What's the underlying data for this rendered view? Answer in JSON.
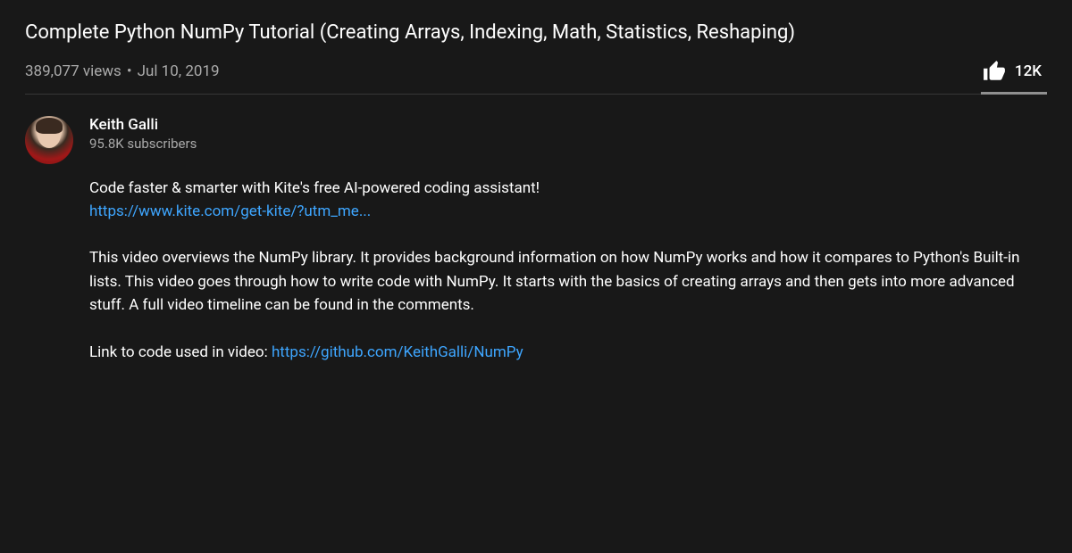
{
  "video": {
    "title": "Complete Python NumPy Tutorial (Creating Arrays, Indexing, Math, Statistics, Reshaping)",
    "views": "389,077 views",
    "date": "Jul 10, 2019",
    "separator": "•",
    "likes": "12K"
  },
  "channel": {
    "name": "Keith Galli",
    "subscribers": "95.8K subscribers"
  },
  "description": {
    "promo_text": "Code faster & smarter with Kite's free AI-powered coding assistant!",
    "promo_link": "https://www.kite.com/get-kite/?utm_me...",
    "body": "This video overviews the NumPy library. It provides background information on how NumPy works and how it compares to Python's Built-in lists. This video goes through how to write code with NumPy. It starts with the basics of creating arrays and then gets into more advanced stuff. A full video timeline can be found in the comments.",
    "code_label": "Link to code used in video: ",
    "code_link": "https://github.com/KeithGalli/NumPy"
  }
}
